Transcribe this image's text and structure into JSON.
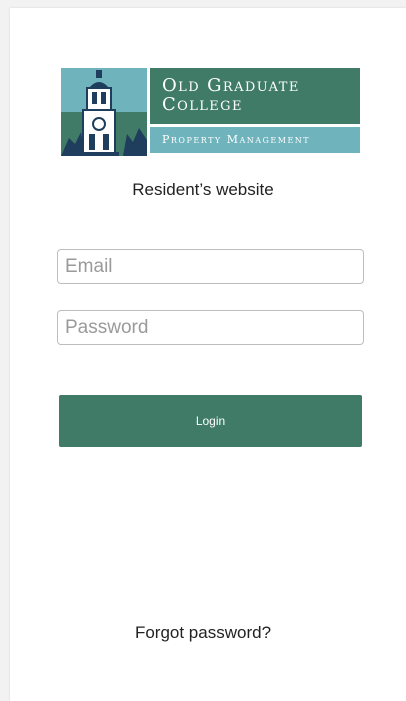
{
  "brand": {
    "title_line1": "Old Graduate",
    "title_line2": "College",
    "subtitle": "Property Management",
    "colors": {
      "green": "#3f7b66",
      "teal": "#6fb3bd",
      "navy": "#1f3d5c"
    }
  },
  "page": {
    "subtitle": "Resident’s website"
  },
  "form": {
    "email_placeholder": "Email",
    "password_placeholder": "Password",
    "login_label": "Login",
    "forgot_label": "Forgot password?"
  }
}
